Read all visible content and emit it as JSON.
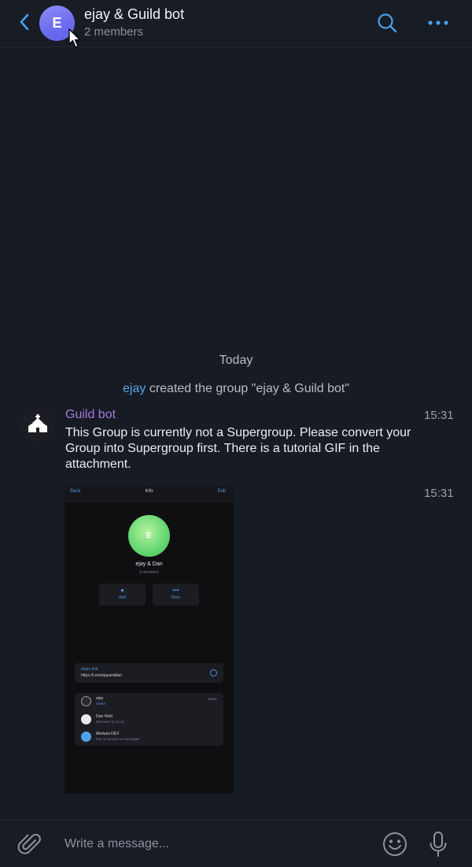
{
  "header": {
    "avatar_letter": "E",
    "title": "ejay & Guild bot",
    "subtitle": "2 members"
  },
  "chat": {
    "date_separator": "Today",
    "service_message": {
      "actor": "ejay",
      "text": "created the group \"ejay & Guild bot\""
    },
    "message": {
      "sender": "Guild bot",
      "text": "This Group is currently not a Supergroup. Please convert your Group into Supergroup first. There is a tutorial GIF in the attachment.",
      "time": "15:31",
      "gif_time": "15:31"
    },
    "gif": {
      "back_label": "Back",
      "title": "Info",
      "edit_label": "Edit",
      "avatar_letter": "E",
      "group_name": "ejay & Dan",
      "member_count": "3 members",
      "add_label": "Add",
      "more_label": "More",
      "share_link_label": "share link",
      "share_link": "https://t.me/ejayanddan",
      "members": [
        {
          "name": "ejay",
          "status": "online",
          "role": "owner"
        },
        {
          "name": "Dan Held",
          "status": "last seen 11.11.21",
          "role": ""
        },
        {
          "name": "Medusa DEV",
          "status": "has no access to messages",
          "role": ""
        }
      ]
    }
  },
  "composer": {
    "placeholder": "Write a message..."
  },
  "colors": {
    "background": "#161b24",
    "accent": "#5aa7e8",
    "sender_name": "#a67bdc",
    "avatar": "#7b7cf0"
  },
  "icons": {
    "back": "chevron-left-icon",
    "search": "search-icon",
    "more": "more-dots-icon",
    "attach": "paperclip-icon",
    "emoji": "smiley-icon",
    "mic": "microphone-icon"
  }
}
